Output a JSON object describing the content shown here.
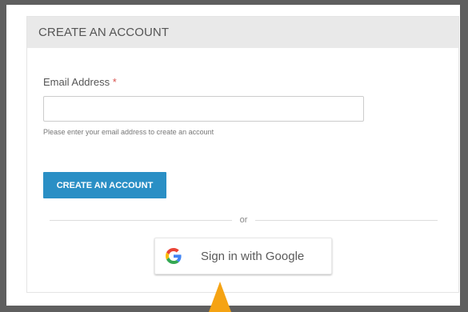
{
  "form": {
    "title": "CREATE AN ACCOUNT",
    "email_label": "Email Address",
    "required_mark": "*",
    "email_value": "",
    "email_placeholder": "",
    "email_hint": "Please enter your email address to create an account",
    "submit_label": "CREATE AN ACCOUNT"
  },
  "divider": {
    "text": "or"
  },
  "google": {
    "label": "Sign in with Google",
    "icon": "google-g-icon"
  },
  "colors": {
    "primary_button": "#2a8fc5",
    "required": "#d9534f",
    "pointer": "#f5a313",
    "backdrop": "#5f5f5f"
  }
}
